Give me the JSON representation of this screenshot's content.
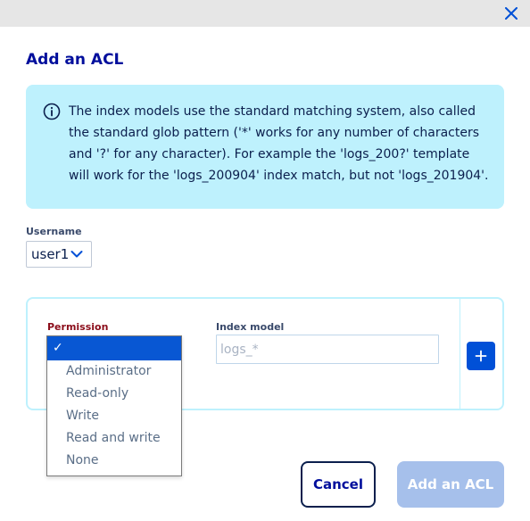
{
  "dialog": {
    "title": "Add an ACL",
    "close_icon": "close-icon"
  },
  "info": {
    "icon": "info-icon",
    "text": "The index models use the standard matching system, also called the standard glob pattern ('*' works for any number of characters and '?' for any character). For example the 'logs_200?' template will work for the 'logs_200904' index match, but not 'logs_201904'."
  },
  "username": {
    "label": "Username",
    "value": "user1"
  },
  "permission": {
    "label": "Permission",
    "selected_mark": "✓",
    "options": [
      "Administrator",
      "Read-only",
      "Write",
      "Read and write",
      "None"
    ]
  },
  "index_model": {
    "label": "Index model",
    "placeholder": "logs_*"
  },
  "buttons": {
    "add_row": "+",
    "cancel": "Cancel",
    "submit": "Add an ACL"
  },
  "colors": {
    "accent": "#0050d7",
    "info_bg": "#bef1fd",
    "title": "#000e9c",
    "required_label": "#8b0d1a",
    "disabled_primary": "#a6c0eb"
  }
}
